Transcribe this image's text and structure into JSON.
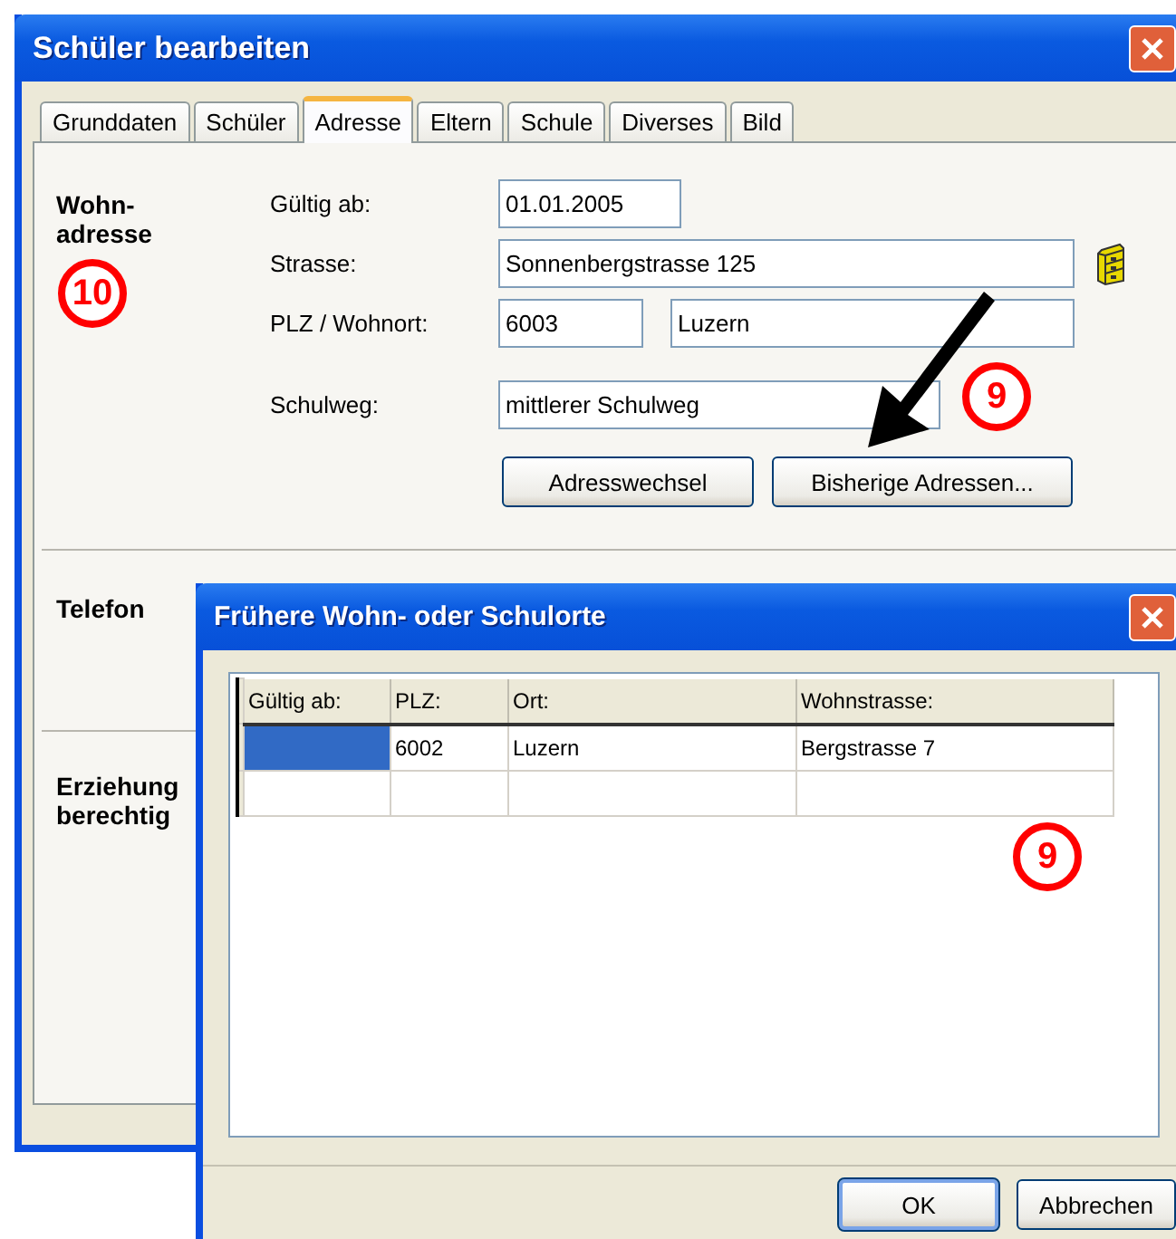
{
  "main_window": {
    "title": "Schüler bearbeiten",
    "tabs": [
      {
        "label": "Grunddaten",
        "selected": false
      },
      {
        "label": "Schüler",
        "selected": false
      },
      {
        "label": "Adresse",
        "selected": true
      },
      {
        "label": "Eltern",
        "selected": false
      },
      {
        "label": "Schule",
        "selected": false
      },
      {
        "label": "Diverses",
        "selected": false
      },
      {
        "label": "Bild",
        "selected": false
      }
    ],
    "address": {
      "heading_1": "Wohn-",
      "heading_2": "adresse",
      "callout": "10",
      "valid_from_label": "Gültig ab:",
      "valid_from": "01.01.2005",
      "street_label": "Strasse:",
      "street": "Sonnenbergstrasse 125",
      "city_label": "PLZ / Wohnort:",
      "zip": "6003",
      "city": "Luzern",
      "route_label": "Schulweg:",
      "route": "mittlerer Schulweg",
      "buttons": [
        "Adresswechsel",
        "Bisherige Adressen..."
      ],
      "button_callout": "9"
    },
    "phone": {
      "heading": "Telefon"
    },
    "guardians": {
      "heading_1": "Erziehung",
      "heading_2": "berechtig"
    }
  },
  "dialog": {
    "title": "Frühere Wohn- oder Schulorte",
    "columns": [
      "Gültig ab:",
      "PLZ:",
      "Ort:",
      "Wohnstrasse:"
    ],
    "rows": [
      {
        "selected": true,
        "zip": "6002",
        "city": "Luzern",
        "street": "Bergstrasse 7"
      }
    ],
    "callout": "9",
    "buttons": [
      "OK",
      "Abbrechen"
    ]
  }
}
